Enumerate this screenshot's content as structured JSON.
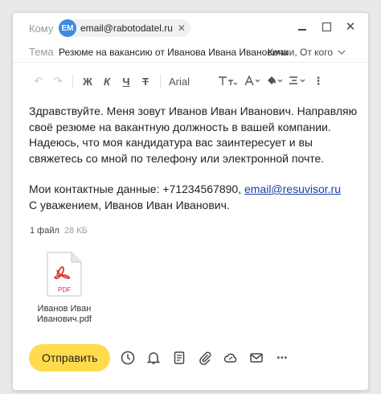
{
  "header": {
    "to_label": "Кому",
    "recipient_initials": "ЕМ",
    "recipient_email": "email@rabotodatel.ru",
    "remove_glyph": "✕",
    "subject_label": "Тема",
    "subject": "Резюме на вакансию от Иванова Ивана Ивановича",
    "copy_toggle": "Копии, От кого"
  },
  "window_controls": {
    "close_glyph": "✕"
  },
  "toolbar": {
    "undo": "↶",
    "redo": "↷",
    "bold": "Ж",
    "italic": "К",
    "underline": "Ч",
    "strike": "Т",
    "font": "Arial",
    "more": "⋮"
  },
  "message": {
    "paragraph1": "Здравствуйте. Меня зовут Иванов Иван Иванович. Направляю своё резюме на вакантную должность в вашей компании. Надеюсь, что моя кандидатура вас заинтересует и вы свяжетесь со мной по телефону или электронной почте.",
    "contacts_prefix": "Мои контактные данные: +71234567890, ",
    "contacts_email": "email@resuvisor.ru",
    "closing": "С уважением, Иванов Иван Иванович."
  },
  "attachments": {
    "count_label": "1 файл",
    "size_label": "28 КБ",
    "items": [
      {
        "type_label": "PDF",
        "name": "Иванов Иван Иванович.pdf"
      }
    ]
  },
  "bottom": {
    "send_label": "Отправить",
    "more_glyph": "•••"
  },
  "colors": {
    "accent_send": "#ffdb4d",
    "avatar": "#3d8ae0",
    "pdf_red": "#e0332a",
    "link": "#1a3ea8"
  },
  "icons": [
    "minimize-icon",
    "maximize-icon",
    "close-icon",
    "chevron-down-icon",
    "undo-icon",
    "redo-icon",
    "clear-format-icon",
    "text-size-icon",
    "text-color-icon",
    "fill-color-icon",
    "align-icon",
    "pdf-icon",
    "clock-icon",
    "bell-icon",
    "template-icon",
    "paperclip-icon",
    "cloud-attach-icon",
    "envelope-icon",
    "more-icon"
  ]
}
